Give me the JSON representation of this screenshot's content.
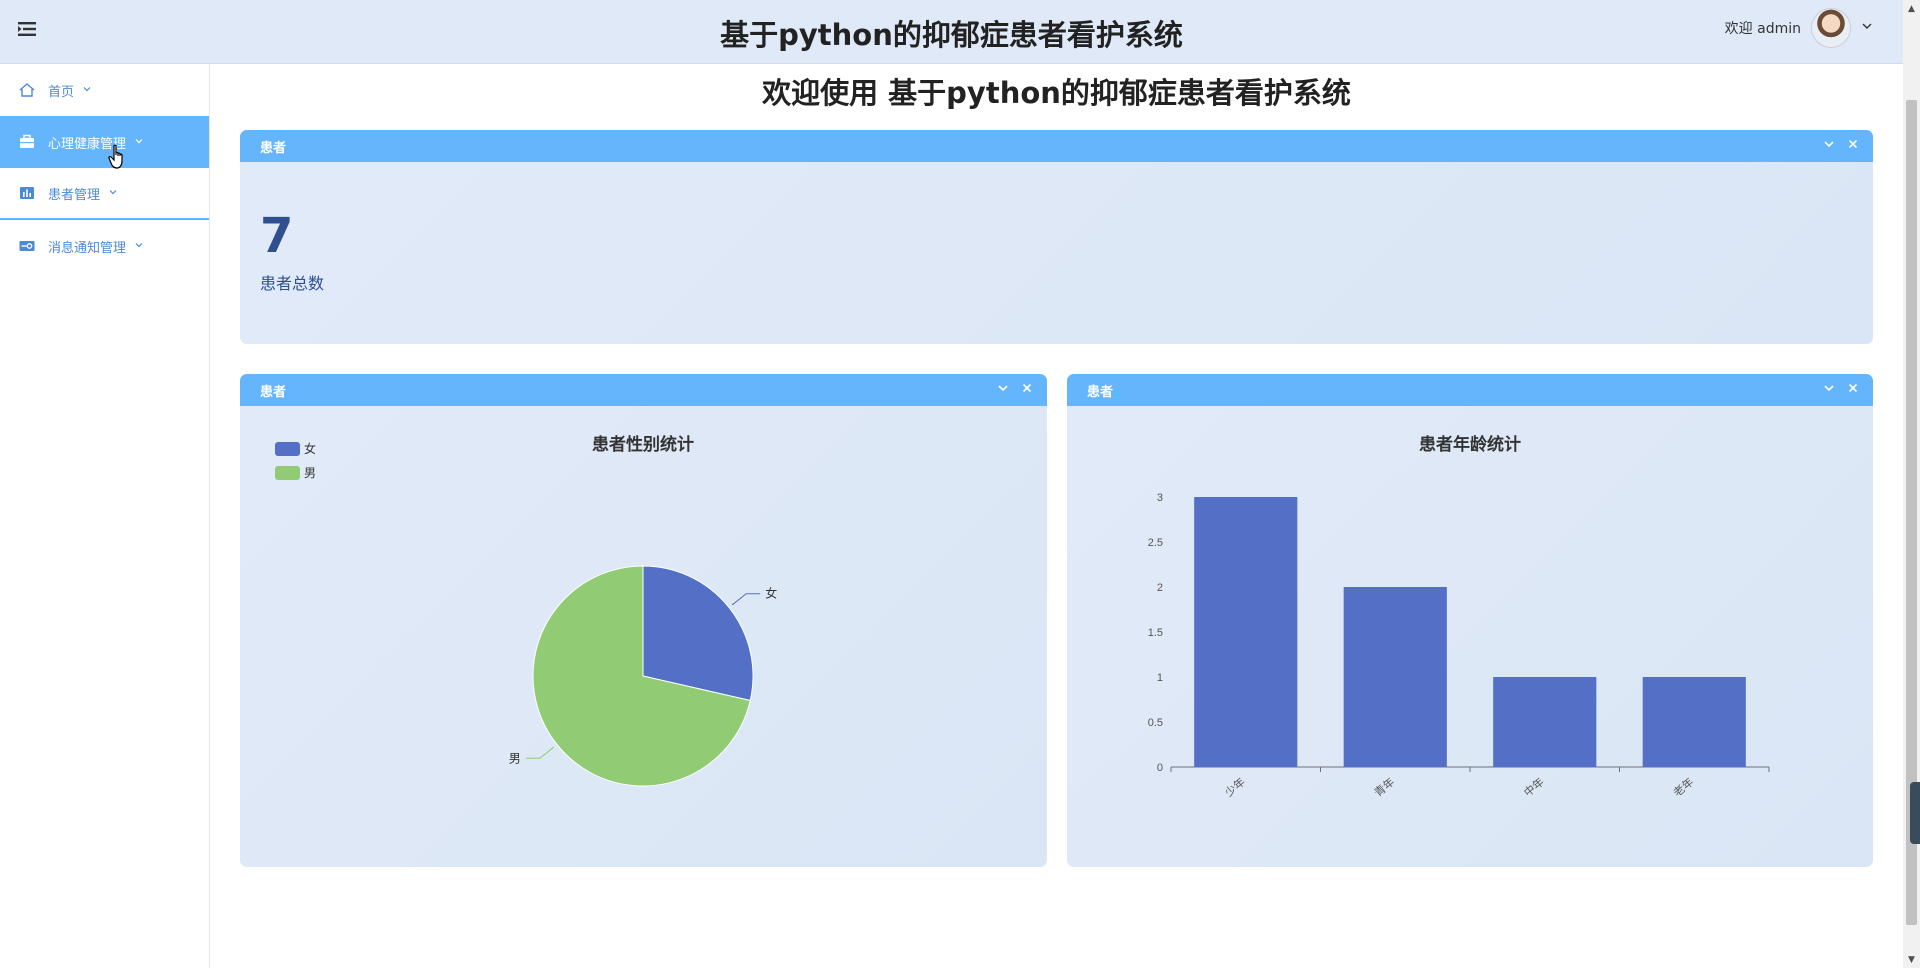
{
  "header": {
    "title": "基于python的抑郁症患者看护系统",
    "user_greeting": "欢迎 admin"
  },
  "sidebar": {
    "items": [
      {
        "label": "首页",
        "icon": "home-icon"
      },
      {
        "label": "心理健康管理",
        "icon": "briefcase-icon",
        "active": true
      },
      {
        "label": "患者管理",
        "icon": "chart-icon"
      },
      {
        "label": "消息通知管理",
        "icon": "settings-card-icon"
      }
    ]
  },
  "main": {
    "welcome": "欢迎使用 基于python的抑郁症患者看护系统",
    "stat_panel": {
      "header": "患者",
      "value": "7",
      "label": "患者总数"
    },
    "gender_panel": {
      "header": "患者"
    },
    "age_panel": {
      "header": "患者"
    }
  },
  "colors": {
    "accent": "#64b5fb",
    "panel_bg": "#dde8f7",
    "series_blue": "#5470c6",
    "series_green": "#91cc75"
  },
  "chart_data": [
    {
      "type": "pie",
      "title": "患者性别统计",
      "legend": [
        "女",
        "男"
      ],
      "legend_position": "top-left",
      "categories": [
        "女",
        "男"
      ],
      "values": [
        2,
        5
      ]
    },
    {
      "type": "bar",
      "title": "患者年龄统计",
      "categories": [
        "少年",
        "青年",
        "中年",
        "老年"
      ],
      "values": [
        3,
        2,
        1,
        1
      ],
      "ylim": [
        0,
        3
      ],
      "yticks": [
        "0",
        "0.5",
        "1",
        "1.5",
        "2",
        "2.5",
        "3"
      ],
      "grid": false
    }
  ]
}
